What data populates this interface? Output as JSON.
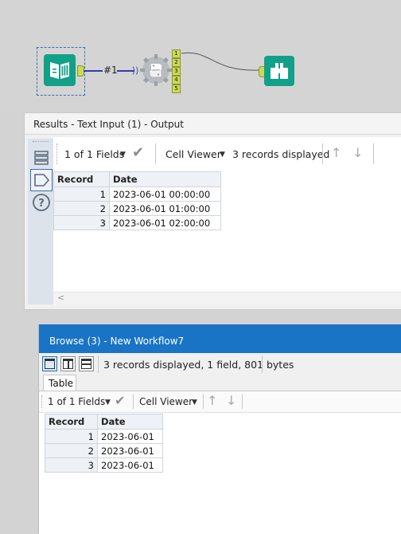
{
  "canvas": {
    "connection_label": "#1",
    "anchor_numbers": [
      "1",
      "2",
      "3",
      "4",
      "5"
    ]
  },
  "results_panel": {
    "title": "Results - Text Input (1) - Output",
    "fields_label": "1 of 1 Fields",
    "viewer_label": "Cell Viewer",
    "records_label": "3 records displayed",
    "table": {
      "headers": [
        "Record",
        "Date"
      ],
      "rows": [
        [
          "1",
          "2023-06-01 00:00:00"
        ],
        [
          "2",
          "2023-06-01 01:00:00"
        ],
        [
          "3",
          "2023-06-01 02:00:00"
        ]
      ]
    }
  },
  "browse_panel": {
    "title": "Browse (3) - New Workflow7",
    "summary": "3 records displayed, 1 field, 801 bytes",
    "tab_label": "Table",
    "fields_label": "1 of 1 Fields",
    "viewer_label": "Cell Viewer",
    "table": {
      "headers": [
        "Record",
        "Date"
      ],
      "rows": [
        [
          "1",
          "2023-06-01"
        ],
        [
          "2",
          "2023-06-01"
        ],
        [
          "3",
          "2023-06-01"
        ]
      ]
    }
  },
  "colors": {
    "tool_teal": "#12a089",
    "connection_blue": "#3a3aa8",
    "browse_title_blue": "#1a74c6",
    "selection_border": "#3b6fb6"
  },
  "icons": [
    "book-input-icon",
    "python-icon",
    "binoculars-icon",
    "checkmark-icon",
    "up-arrow-icon",
    "down-arrow-icon",
    "question-icon",
    "tag-icon",
    "stack-icon"
  ]
}
